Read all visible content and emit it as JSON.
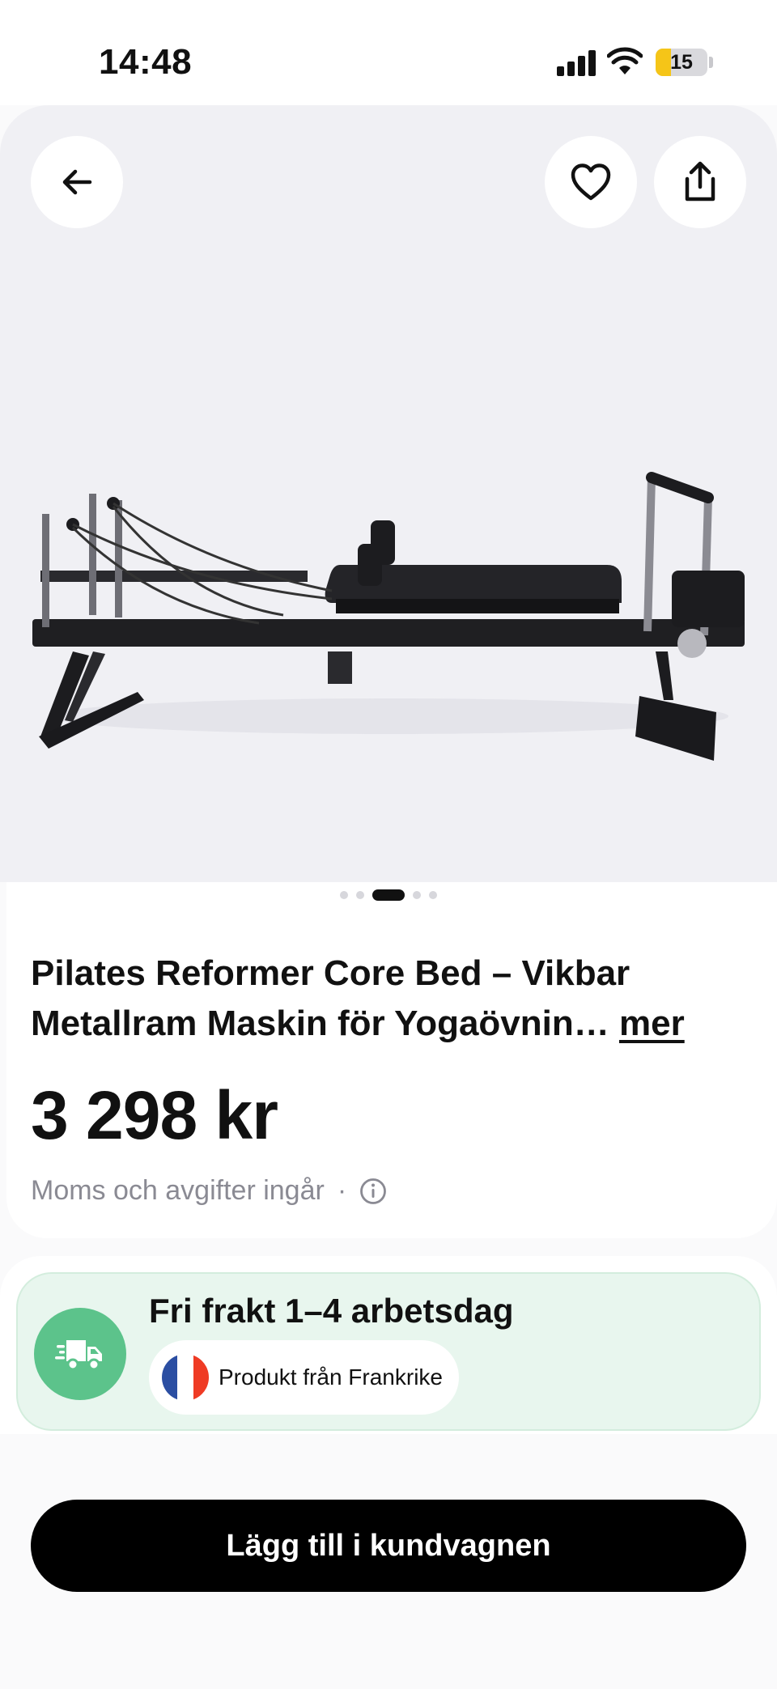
{
  "status_bar": {
    "time": "14:48",
    "battery_level": "15",
    "icons": [
      "signal-icon",
      "wifi-icon",
      "battery-icon"
    ]
  },
  "hero": {
    "image_alt": "pilates-reformer-image",
    "carousel": {
      "dot_count": 5,
      "active_index": 2
    },
    "buttons": {
      "back": "arrow-left-icon",
      "favorite": "heart-icon",
      "share": "share-icon"
    }
  },
  "product": {
    "title": "Pilates Reformer Core Bed – Vikbar Metallram Maskin för Yogaövnin…",
    "more_label": "mer",
    "price": "3 298 kr",
    "tax_note": "Moms och avgifter ingår",
    "tax_separator": "·"
  },
  "shipping": {
    "title": "Fri frakt 1–4  arbetsdag",
    "origin": "Produkt från Frankrike",
    "colors": {
      "background": "#e8f6ee",
      "truck_circle": "#5cc38b"
    }
  },
  "actions": {
    "add_to_cart": "Lägg till i kundvagnen"
  }
}
